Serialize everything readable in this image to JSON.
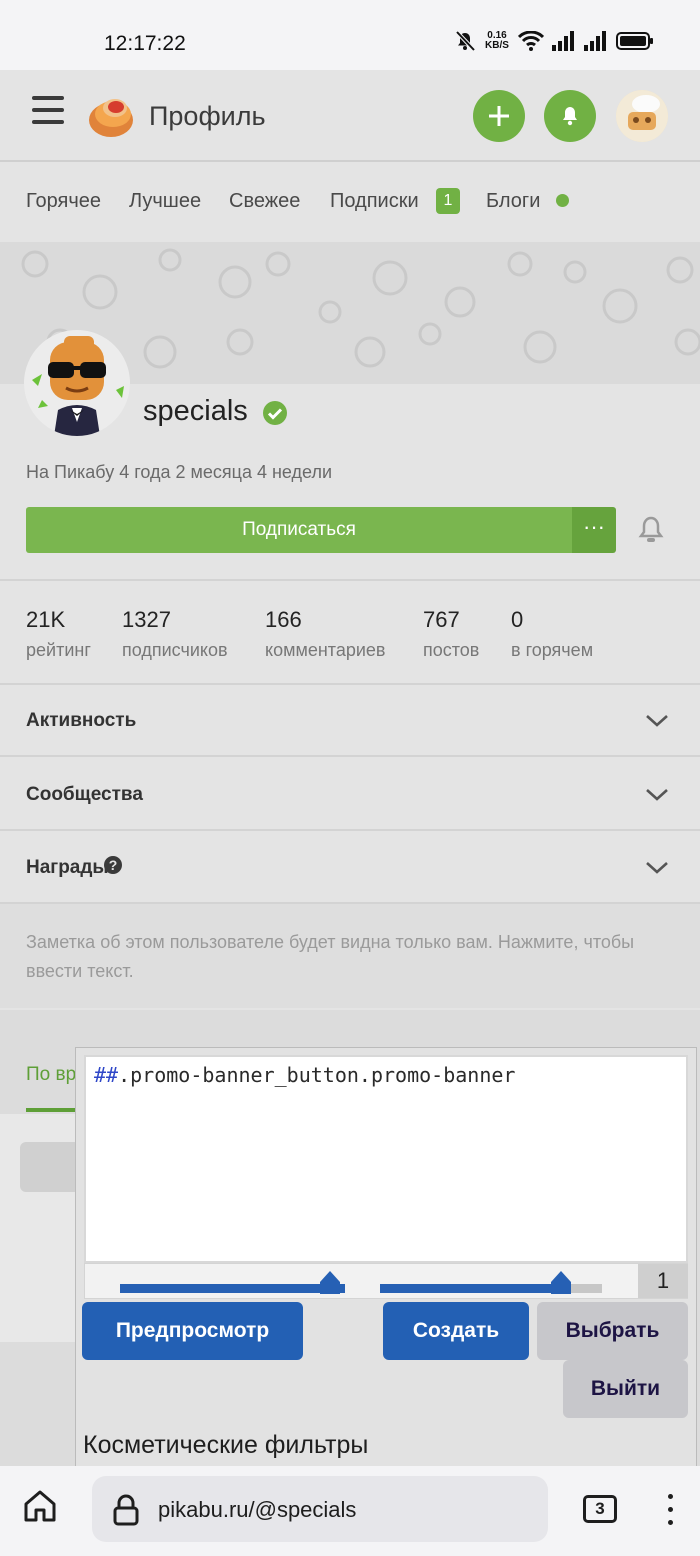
{
  "status_bar": {
    "time": "12:17:22",
    "net_speed_value": "0.16",
    "net_speed_unit": "KB/S",
    "icons": [
      "mute-icon",
      "wifi-icon",
      "signal-icon",
      "signal-icon",
      "battery-icon"
    ]
  },
  "header": {
    "title": "Профиль",
    "icons": [
      "menu-icon",
      "pikabu-logo",
      "plus-icon",
      "bell-icon",
      "avatar"
    ]
  },
  "tabs": [
    {
      "label": "Горячее"
    },
    {
      "label": "Лучшее"
    },
    {
      "label": "Свежее"
    },
    {
      "label": "Подписки",
      "badge": "1"
    },
    {
      "label": "Блоги"
    }
  ],
  "profile": {
    "username": "specials",
    "on_site": "На Пикабу 4 года 2 месяца 4 недели",
    "subscribe_label": "Подписаться",
    "more_label": "···"
  },
  "stats": [
    {
      "value": "21K",
      "label": "рейтинг"
    },
    {
      "value": "1327",
      "label": "подписчиков"
    },
    {
      "value": "166",
      "label": "комментариев"
    },
    {
      "value": "767",
      "label": "постов"
    },
    {
      "value": "0",
      "label": "в горячем"
    }
  ],
  "sections": [
    {
      "label": "Активность"
    },
    {
      "label": "Сообщества"
    },
    {
      "label": "Награды",
      "help": "?"
    }
  ],
  "note_text": "Заметка об этом пользователе будет видна только вам. Нажмите, чтобы ввести текст.",
  "posts_tab_partial": "По вр",
  "filter_dialog": {
    "rule_prefix": "##",
    "rule_body": ".promo-banner_button.promo-banner",
    "count": "1",
    "preview_label": "Предпросмотр",
    "create_label": "Создать",
    "pick_label": "Выбрать",
    "exit_label": "Выйти",
    "section_title": "Косметические фильтры"
  },
  "browser": {
    "url": "pikabu.ru/@specials",
    "tabs_count": "3"
  },
  "colors": {
    "accent_green": "#71b144",
    "dialog_blue": "#2360b4"
  }
}
